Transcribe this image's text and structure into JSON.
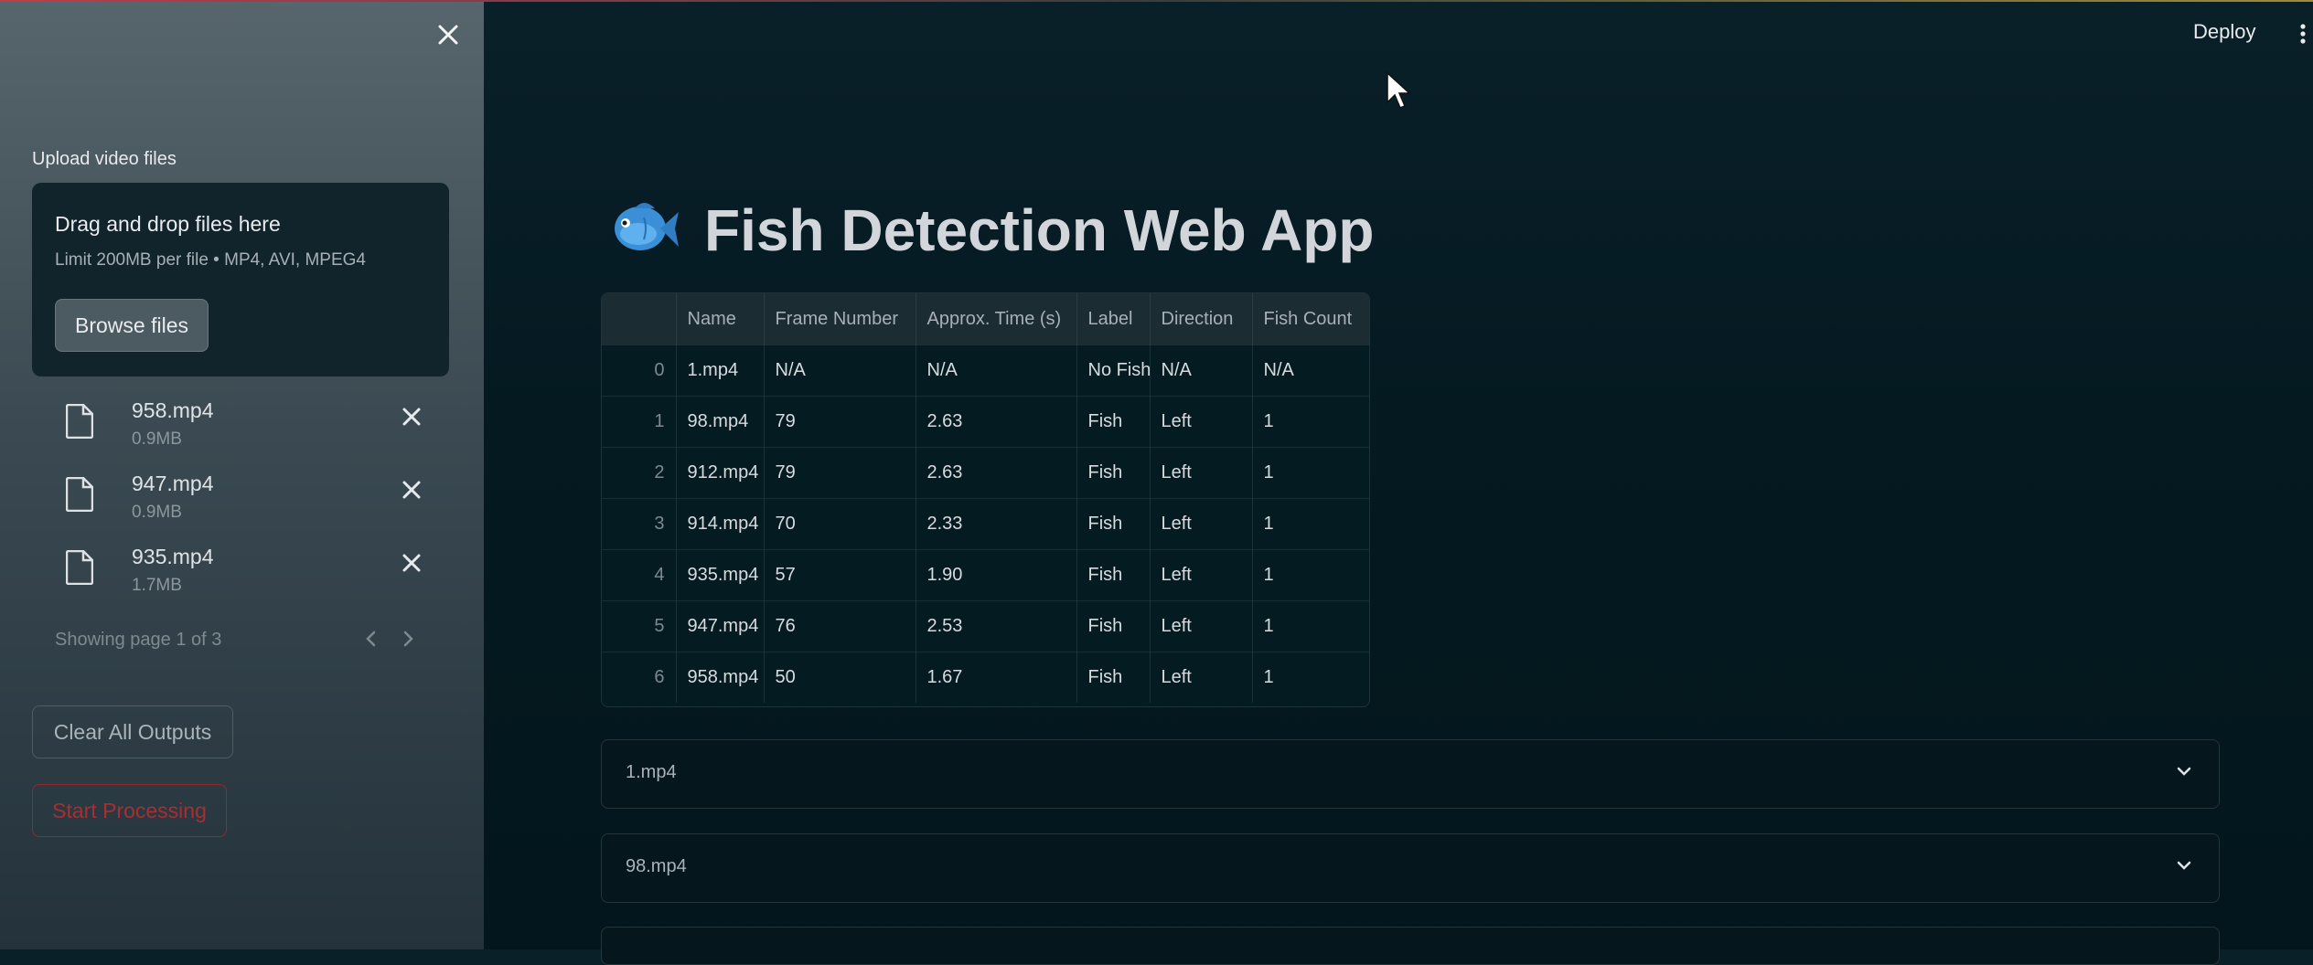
{
  "app": {
    "title": "Fish Detection Web App",
    "deploy_label": "Deploy"
  },
  "sidebar": {
    "upload_label": "Upload video files",
    "dropzone": {
      "title": "Drag and drop files here",
      "subtitle": "Limit 200MB per file • MP4, AVI, MPEG4",
      "browse_label": "Browse files"
    },
    "files": [
      {
        "name": "958.mp4",
        "size": "0.9MB"
      },
      {
        "name": "947.mp4",
        "size": "0.9MB"
      },
      {
        "name": "935.mp4",
        "size": "1.7MB"
      }
    ],
    "pager_text": "Showing page 1 of 3",
    "clear_label": "Clear All Outputs",
    "start_label": "Start Processing"
  },
  "table": {
    "columns": [
      "",
      "Name",
      "Frame Number",
      "Approx. Time (s)",
      "Label",
      "Direction",
      "Fish Count"
    ],
    "rows": [
      [
        "0",
        "1.mp4",
        "N/A",
        "N/A",
        "No Fish",
        "N/A",
        "N/A"
      ],
      [
        "1",
        "98.mp4",
        "79",
        "2.63",
        "Fish",
        "Left",
        "1"
      ],
      [
        "2",
        "912.mp4",
        "79",
        "2.63",
        "Fish",
        "Left",
        "1"
      ],
      [
        "3",
        "914.mp4",
        "70",
        "2.33",
        "Fish",
        "Left",
        "1"
      ],
      [
        "4",
        "935.mp4",
        "57",
        "1.90",
        "Fish",
        "Left",
        "1"
      ],
      [
        "5",
        "947.mp4",
        "76",
        "2.53",
        "Fish",
        "Left",
        "1"
      ],
      [
        "6",
        "958.mp4",
        "50",
        "1.67",
        "Fish",
        "Left",
        "1"
      ]
    ]
  },
  "expanders": [
    {
      "label": "1.mp4"
    },
    {
      "label": "98.mp4"
    }
  ],
  "icons": {
    "close": "close-icon",
    "file": "file-icon",
    "chevron_left": "chevron-left-icon",
    "chevron_right": "chevron-right-icon",
    "chevron_down": "chevron-down-icon",
    "menu": "kebab-menu-icon",
    "title_emoji": "fish-icon",
    "pointer": "mouse-cursor-icon"
  },
  "colors": {
    "main_bg": "#041920",
    "sidebar_bg": "#3b4a52",
    "start_accent": "#a82e31"
  }
}
